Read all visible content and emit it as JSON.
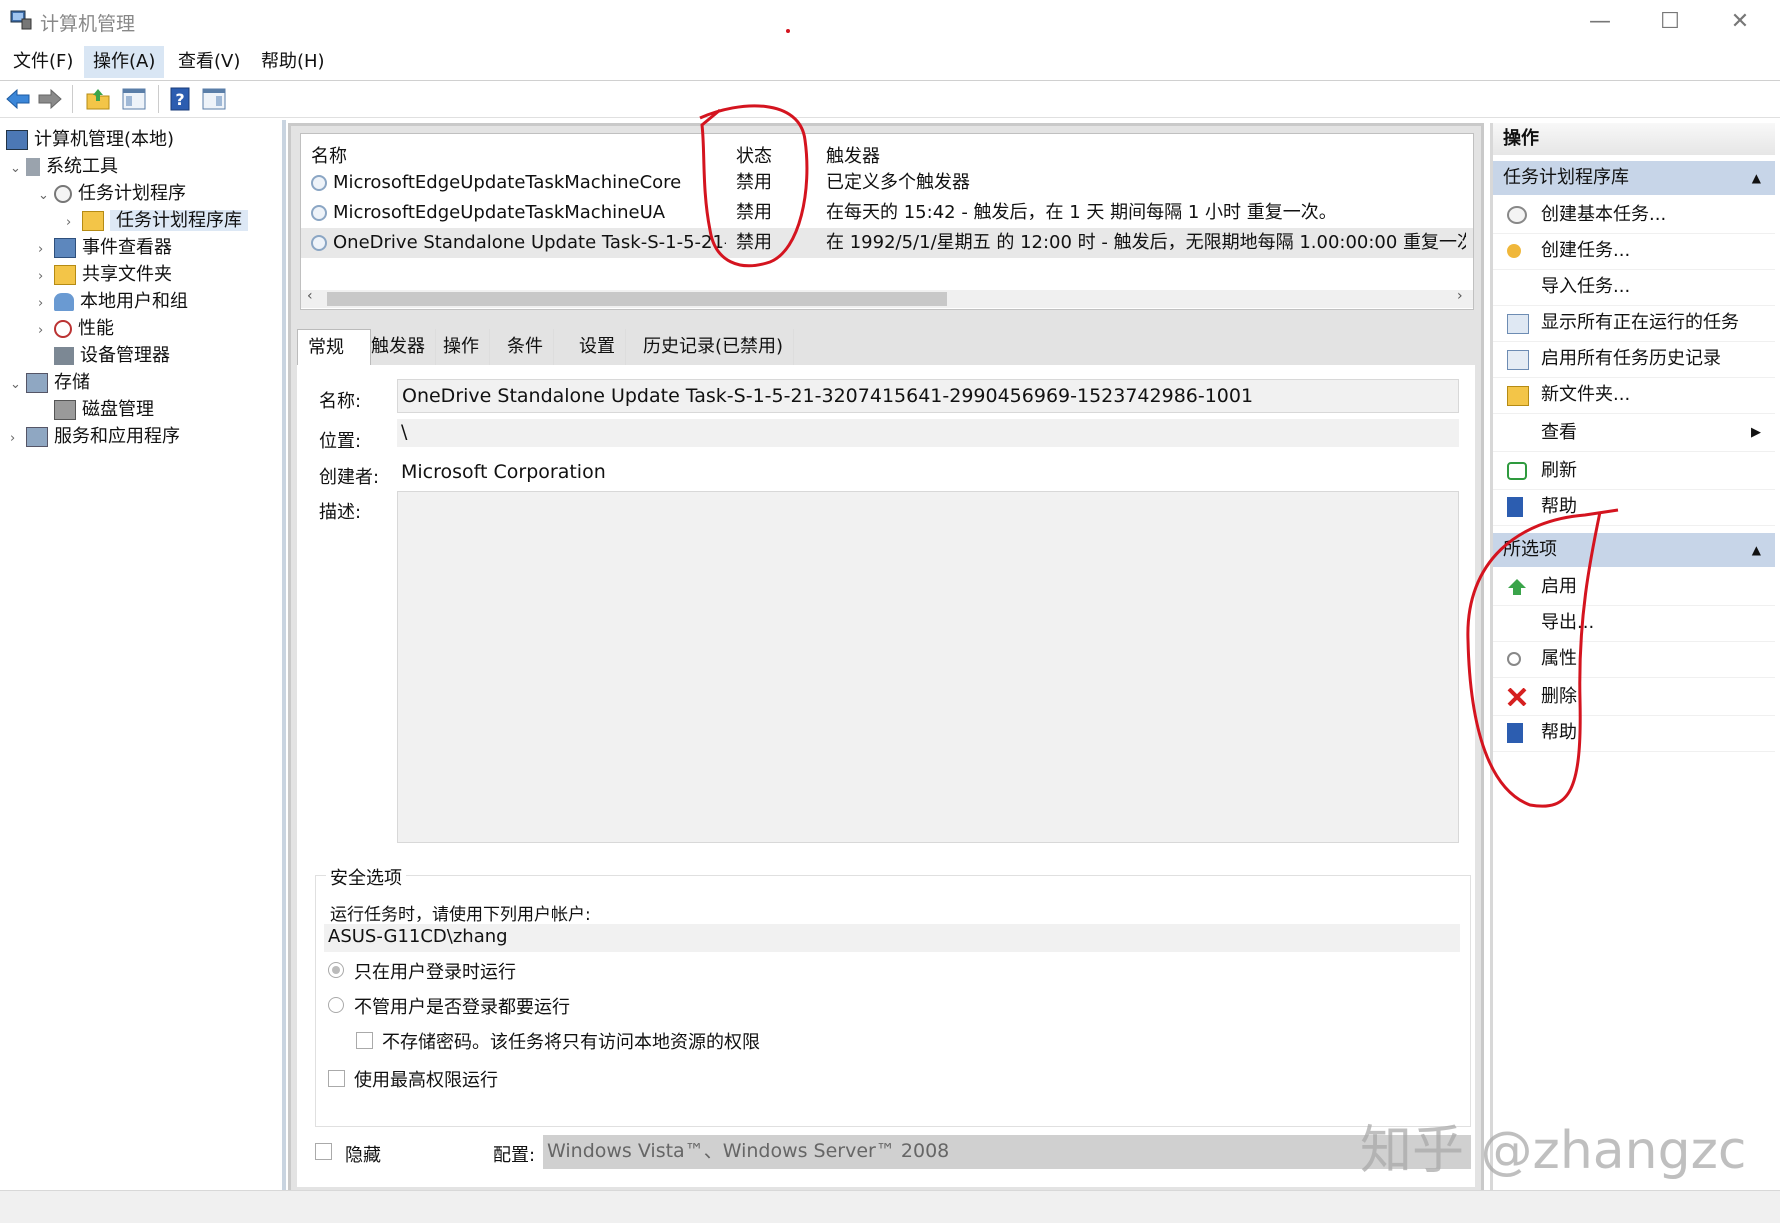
{
  "window": {
    "title": "计算机管理"
  },
  "menu": [
    "文件(F)",
    "操作(A)",
    "查看(V)",
    "帮助(H)"
  ],
  "tree": [
    {
      "label": "计算机管理(本地)",
      "level": 0
    },
    {
      "label": "系统工具",
      "level": 1
    },
    {
      "label": "任务计划程序",
      "level": 2
    },
    {
      "label": "任务计划程序库",
      "level": 3
    },
    {
      "label": "事件查看器",
      "level": 2
    },
    {
      "label": "共享文件夹",
      "level": 2
    },
    {
      "label": "本地用户和组",
      "level": 2
    },
    {
      "label": "性能",
      "level": 2
    },
    {
      "label": "设备管理器",
      "level": 2
    },
    {
      "label": "存储",
      "level": 1
    },
    {
      "label": "磁盘管理",
      "level": 2
    },
    {
      "label": "服务和应用程序",
      "level": 1
    }
  ],
  "tasklist": {
    "columns": [
      "名称",
      "状态",
      "触发器"
    ],
    "rows": [
      {
        "name": "MicrosoftEdgeUpdateTaskMachineCore",
        "status": "禁用",
        "trigger": "已定义多个触发器"
      },
      {
        "name": "MicrosoftEdgeUpdateTaskMachineUA",
        "status": "禁用",
        "trigger": "在每天的 15:42 - 触发后，在 1 天 期间每隔 1 小时 重复一次。"
      },
      {
        "name": "OneDrive Standalone Update Task-S-1-5-21-...",
        "status": "禁用",
        "trigger": "在 1992/5/1/星期五 的 12:00 时 - 触发后，无限期地每隔 1.00:00:00 重复一次。"
      }
    ]
  },
  "tabs": [
    "常规",
    "触发器",
    "操作",
    "条件",
    "设置",
    "历史记录(已禁用)"
  ],
  "general": {
    "name_label": "名称:",
    "name_value": "OneDrive Standalone Update Task-S-1-5-21-3207415641-2990456969-1523742986-1001",
    "location_label": "位置:",
    "location_value": "\\",
    "author_label": "创建者:",
    "author_value": "Microsoft Corporation",
    "desc_label": "描述:",
    "desc_value": "",
    "security": {
      "group_label": "安全选项",
      "run_as_label": "运行任务时，请使用下列用户帐户:",
      "account": "ASUS-G11CD\\zhang",
      "opt_logged_on": "只在用户登录时运行",
      "opt_whether": "不管用户是否登录都要运行",
      "opt_no_password": "不存储密码。该任务将只有访问本地资源的权限",
      "opt_highest": "使用最高权限运行"
    },
    "hidden_label": "隐藏",
    "config_label": "配置:",
    "config_value": "Windows Vista™、Windows Server™ 2008"
  },
  "actions": {
    "header": "操作",
    "library_section": "任务计划程序库",
    "library_items": [
      "创建基本任务...",
      "创建任务...",
      "导入任务...",
      "显示所有正在运行的任务",
      "启用所有任务历史记录",
      "新文件夹...",
      "查看",
      "刷新",
      "帮助"
    ],
    "selected_section": "所选项",
    "selected_items": [
      "启用",
      "导出...",
      "属性",
      "删除",
      "帮助"
    ]
  },
  "watermark": "知乎 @zhangzc",
  "colors": {
    "annotation": "#d4141f",
    "section_header": "#c7d5e8",
    "selection": "#dde8f5"
  }
}
